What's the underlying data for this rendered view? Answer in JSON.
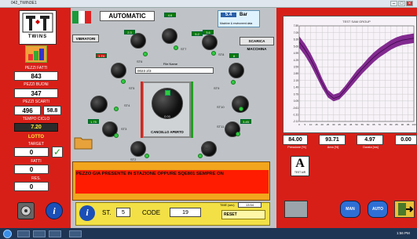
{
  "window": {
    "title": "042_TWIN3E1"
  },
  "left": {
    "brand": "TWINS",
    "pezzi_fatti_label": "PEZZI FATTI",
    "pezzi_fatti": "843",
    "pezzi_buoni_label": "PEZZI BUONI",
    "pezzi_buoni": "347",
    "pezzi_scarti_label": "PEZZI SCARTI",
    "pezzi_scarti": "496",
    "scarti_pct": "58.8",
    "tempo_ciclo_label": "TEMPO CICLO",
    "tempo_ciclo": "7.20",
    "lotto_label": "LOTTO",
    "target_label": "TARGET",
    "target": "0",
    "fatti_label": "FATTI",
    "fatti": "0",
    "res_label": "RES.",
    "res": "0"
  },
  "center": {
    "mode": "AUTOMATIC",
    "pressure_value": "5.4",
    "pressure_unit": "Bar",
    "env_caption": "Machine & enviroment data",
    "vibratori": "VIBRATORI",
    "scarica_macchina": "SCARICA MACCHINA",
    "file_name_label": "File Name",
    "file_name_value": "0023 2/3",
    "cancello": "CANCELLO APERTO",
    "knob_value": "0.00",
    "stations": [
      "ST6",
      "ST7",
      "ST8",
      "ST5",
      "ST9",
      "ST4",
      "ST10",
      "ST3",
      "ST11",
      "ST2",
      "ST12"
    ],
    "small_values": [
      "4.6",
      "2.3",
      "3.6",
      "1.74",
      "8",
      "1.75",
      "3.45",
      "5.2"
    ],
    "message": "PEZZO GIA PRESENTE IN STAZIONE OPPURE SQE801 SEMPRE ON",
    "st_label": "ST.",
    "st_value": "5",
    "code_label": "CODE",
    "code_value": "19",
    "time_label": "TIME (sec)",
    "time_value": "13:54",
    "reset": "RESET"
  },
  "right": {
    "chart_title": "TEST SAM GROUP",
    "values": [
      "84.00",
      "93.71",
      "4.97",
      "0.00"
    ],
    "captions": [
      "Pressione [%]",
      "Area [%]",
      "Durata [ms]",
      ""
    ],
    "test_air": "TEST AIR",
    "man": "MAN",
    "auto": "AUTO"
  },
  "taskbar": {
    "time": "1:56 PM"
  },
  "chart_data": {
    "type": "line",
    "title": "TEST SAM GROUP",
    "x": [
      0,
      5,
      10,
      15,
      20,
      25,
      30,
      35,
      40,
      45,
      50,
      55,
      60,
      65,
      70,
      75,
      80,
      85,
      90,
      95,
      100
    ],
    "x_tick_labels": [
      "0",
      "5",
      "10",
      "15",
      "20",
      "25",
      "30",
      "35",
      "40",
      "45",
      "50",
      "55",
      "60",
      "65",
      "70",
      "75",
      "80",
      "85",
      "90",
      "95",
      "100"
    ],
    "y_tick_labels": [
      "7.89",
      "7.09",
      "6.39",
      "5.69",
      "4.99",
      "4.29",
      "3.59",
      "2.89",
      "2.19",
      "1.49",
      "0.79",
      "0.09",
      "-0.61",
      "-1.31",
      "-2.11"
    ],
    "ylim": [
      -2.11,
      7.89
    ],
    "series": [
      {
        "values": [
          6.8,
          6.0,
          5.0,
          3.8,
          2.4,
          1.2,
          0.7,
          0.9,
          1.6,
          2.4,
          3.2,
          3.8,
          4.5,
          5.1,
          5.6,
          6.0,
          6.4,
          6.7,
          6.9,
          7.0,
          7.1
        ]
      },
      {
        "values": [
          5.6,
          4.8,
          3.8,
          2.6,
          1.4,
          0.4,
          0.0,
          0.2,
          0.8,
          1.5,
          2.2,
          2.9,
          3.5,
          4.1,
          4.6,
          5.0,
          5.4,
          5.7,
          5.9,
          6.0,
          6.1
        ]
      },
      {
        "values": [
          6.2,
          5.4,
          4.4,
          3.2,
          1.9,
          0.8,
          0.3,
          0.5,
          1.2,
          2.0,
          2.7,
          3.4,
          4.0,
          4.6,
          5.1,
          5.5,
          5.9,
          6.2,
          6.4,
          6.5,
          6.6
        ]
      }
    ],
    "grid": true,
    "colors": {
      "band": "#7b1f8a",
      "line": "#3d0a4a"
    }
  }
}
